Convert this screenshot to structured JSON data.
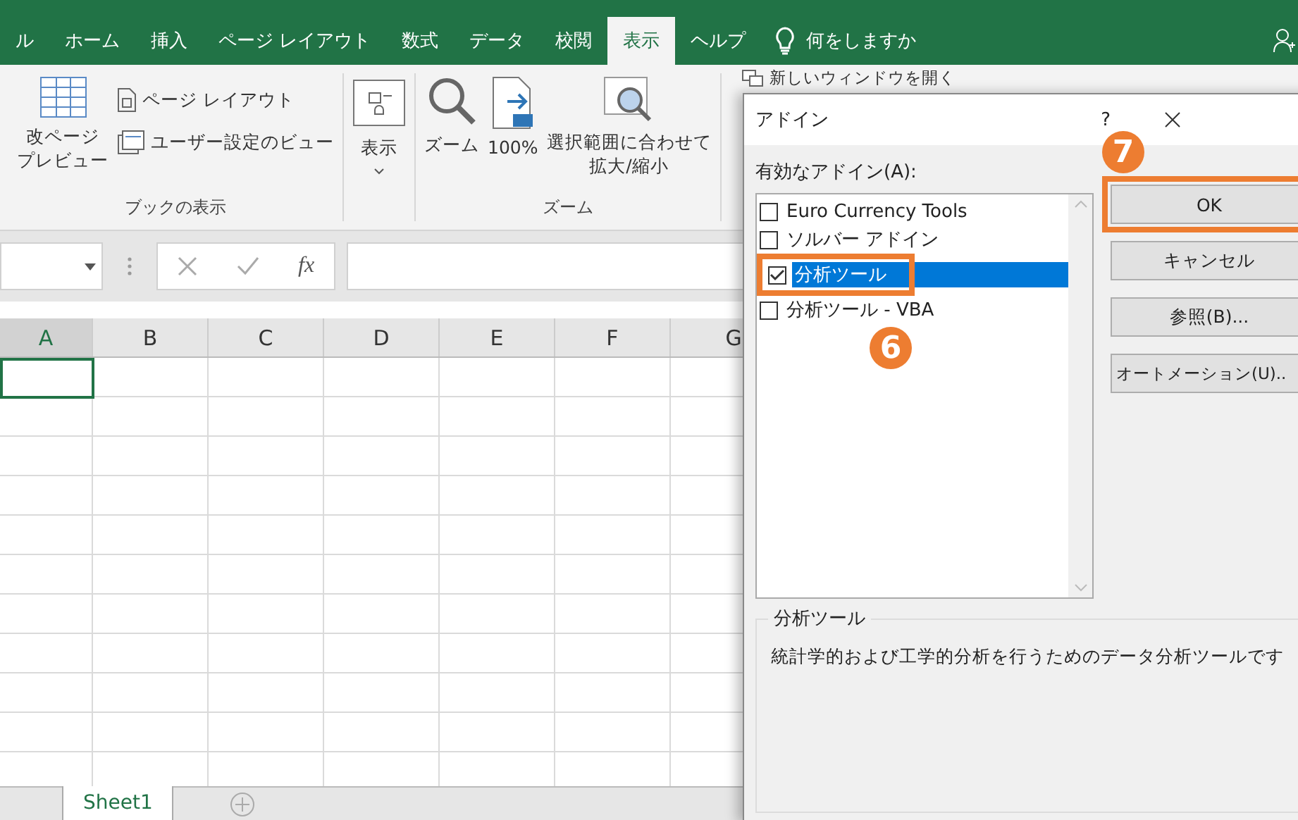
{
  "ribbon_tabs": [
    {
      "label": "ル",
      "selected": false
    },
    {
      "label": "ホーム",
      "selected": false
    },
    {
      "label": "挿入",
      "selected": false
    },
    {
      "label": "ページ レイアウト",
      "selected": false
    },
    {
      "label": "数式",
      "selected": false
    },
    {
      "label": "データ",
      "selected": false
    },
    {
      "label": "校閲",
      "selected": false
    },
    {
      "label": "表示",
      "selected": true
    },
    {
      "label": "ヘルプ",
      "selected": false
    }
  ],
  "tell_me": "何をしますか",
  "ribbon_groups": [
    {
      "label": "ブックの表示",
      "buttons": [
        {
          "kind": "large",
          "lines": [
            "改ページ",
            "プレビュー"
          ]
        },
        {
          "kind": "small",
          "lines": [
            "ページ レイアウト"
          ]
        },
        {
          "kind": "small",
          "lines": [
            "ユーザー設定のビュー"
          ]
        }
      ]
    },
    {
      "buttons": [
        {
          "kind": "dropdown",
          "lines": [
            "表示"
          ]
        }
      ]
    },
    {
      "label": "ズーム",
      "buttons": [
        {
          "kind": "large",
          "lines": [
            "ズーム"
          ]
        },
        {
          "kind": "large",
          "lines": [
            "100%"
          ]
        },
        {
          "kind": "large",
          "lines": [
            "選択範囲に合わせて",
            "拡大/縮小"
          ]
        }
      ]
    }
  ],
  "window_group": {
    "label": "新しいウィンドウを開く"
  },
  "formula_bar": {
    "fx": "fx"
  },
  "columns": [
    {
      "label": "A",
      "selected": true
    },
    {
      "label": "B",
      "selected": false
    },
    {
      "label": "C",
      "selected": false
    },
    {
      "label": "D",
      "selected": false
    },
    {
      "label": "E",
      "selected": false
    },
    {
      "label": "F",
      "selected": false
    },
    {
      "label": "G",
      "selected": false
    }
  ],
  "sheet_tabs": [
    {
      "label": "Sheet1",
      "selected": true
    }
  ],
  "dialog": {
    "title": "アドイン",
    "help": "?",
    "list_label": "有効なアドイン(A):",
    "addins": [
      {
        "label": "Euro Currency Tools",
        "checked": false,
        "selected": false
      },
      {
        "label": "ソルバー アドイン",
        "checked": false,
        "selected": false
      },
      {
        "label": "分析ツール",
        "checked": true,
        "selected": true
      },
      {
        "label": "分析ツール - VBA",
        "checked": false,
        "selected": false
      }
    ],
    "buttons": [
      "OK",
      "キャンセル",
      "参照(B)...",
      "オートメーション(U).."
    ],
    "description_title": "分析ツール",
    "description": "統計学的および工学的分析を行うためのデータ分析ツールです"
  },
  "callouts": [
    {
      "number": "6"
    },
    {
      "number": "7"
    }
  ]
}
